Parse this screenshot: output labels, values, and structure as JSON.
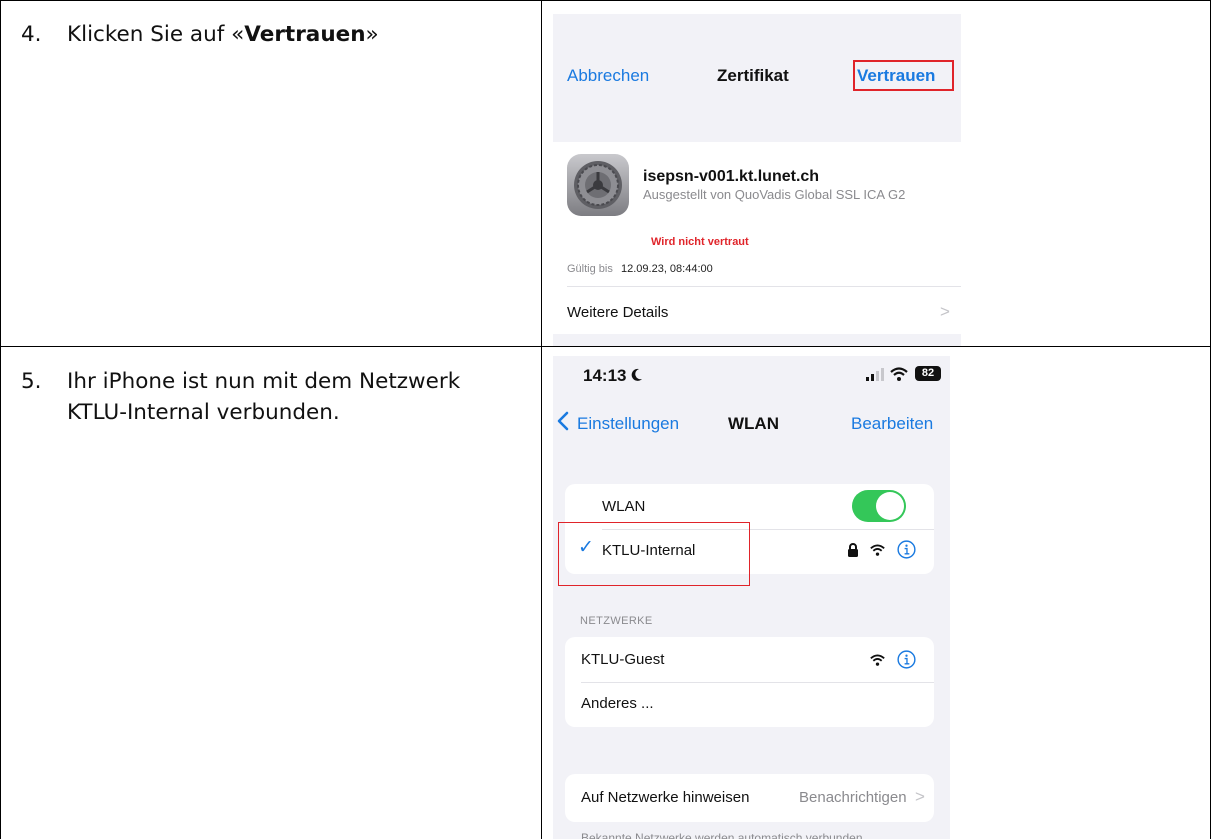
{
  "steps": [
    {
      "number": "4.",
      "text_before": "Klicken Sie auf «",
      "text_bold": "Vertrauen",
      "text_after": "»"
    },
    {
      "number": "5.",
      "text": "Ihr iPhone ist nun mit dem Netzwerk KTLU-Internal verbunden."
    }
  ],
  "certificate_screen": {
    "cancel_label": "Abbrechen",
    "title": "Zertifikat",
    "trust_label": "Vertrauen",
    "icon": "settings-gear-icon",
    "hostname": "isepsn-v001.kt.lunet.ch",
    "issuer": "Ausgestellt von QuoVadis Global SSL ICA G2",
    "trust_status": "Wird nicht vertraut",
    "valid_until_label": "Gültig bis",
    "valid_until_value": "12.09.23, 08:44:00",
    "details_label": "Weitere Details",
    "details_chevron": ">"
  },
  "wlan_screen": {
    "status_time": "14:13",
    "moon_icon": "moon-icon",
    "battery": "82",
    "back_chevron": "<",
    "back_label": "Einstellungen",
    "title": "WLAN",
    "edit_label": "Bearbeiten",
    "wlan_toggle_label": "WLAN",
    "wlan_on": true,
    "connected_check": "✓",
    "connected_network": "KTLU-Internal",
    "networks_header": "NETZWERKE",
    "networks": [
      {
        "name": "KTLU-Guest"
      },
      {
        "name": "Anderes ..."
      }
    ],
    "notify_label": "Auf Netzwerke hinweisen",
    "notify_value": "Benachrichtigen",
    "notify_chevron": ">",
    "footer_text": "Bekannte Netzwerke werden automatisch verbunden."
  },
  "colors": {
    "accent": "#1a7ae0",
    "highlight": "#e0242a",
    "toggle_on": "#34c759"
  }
}
